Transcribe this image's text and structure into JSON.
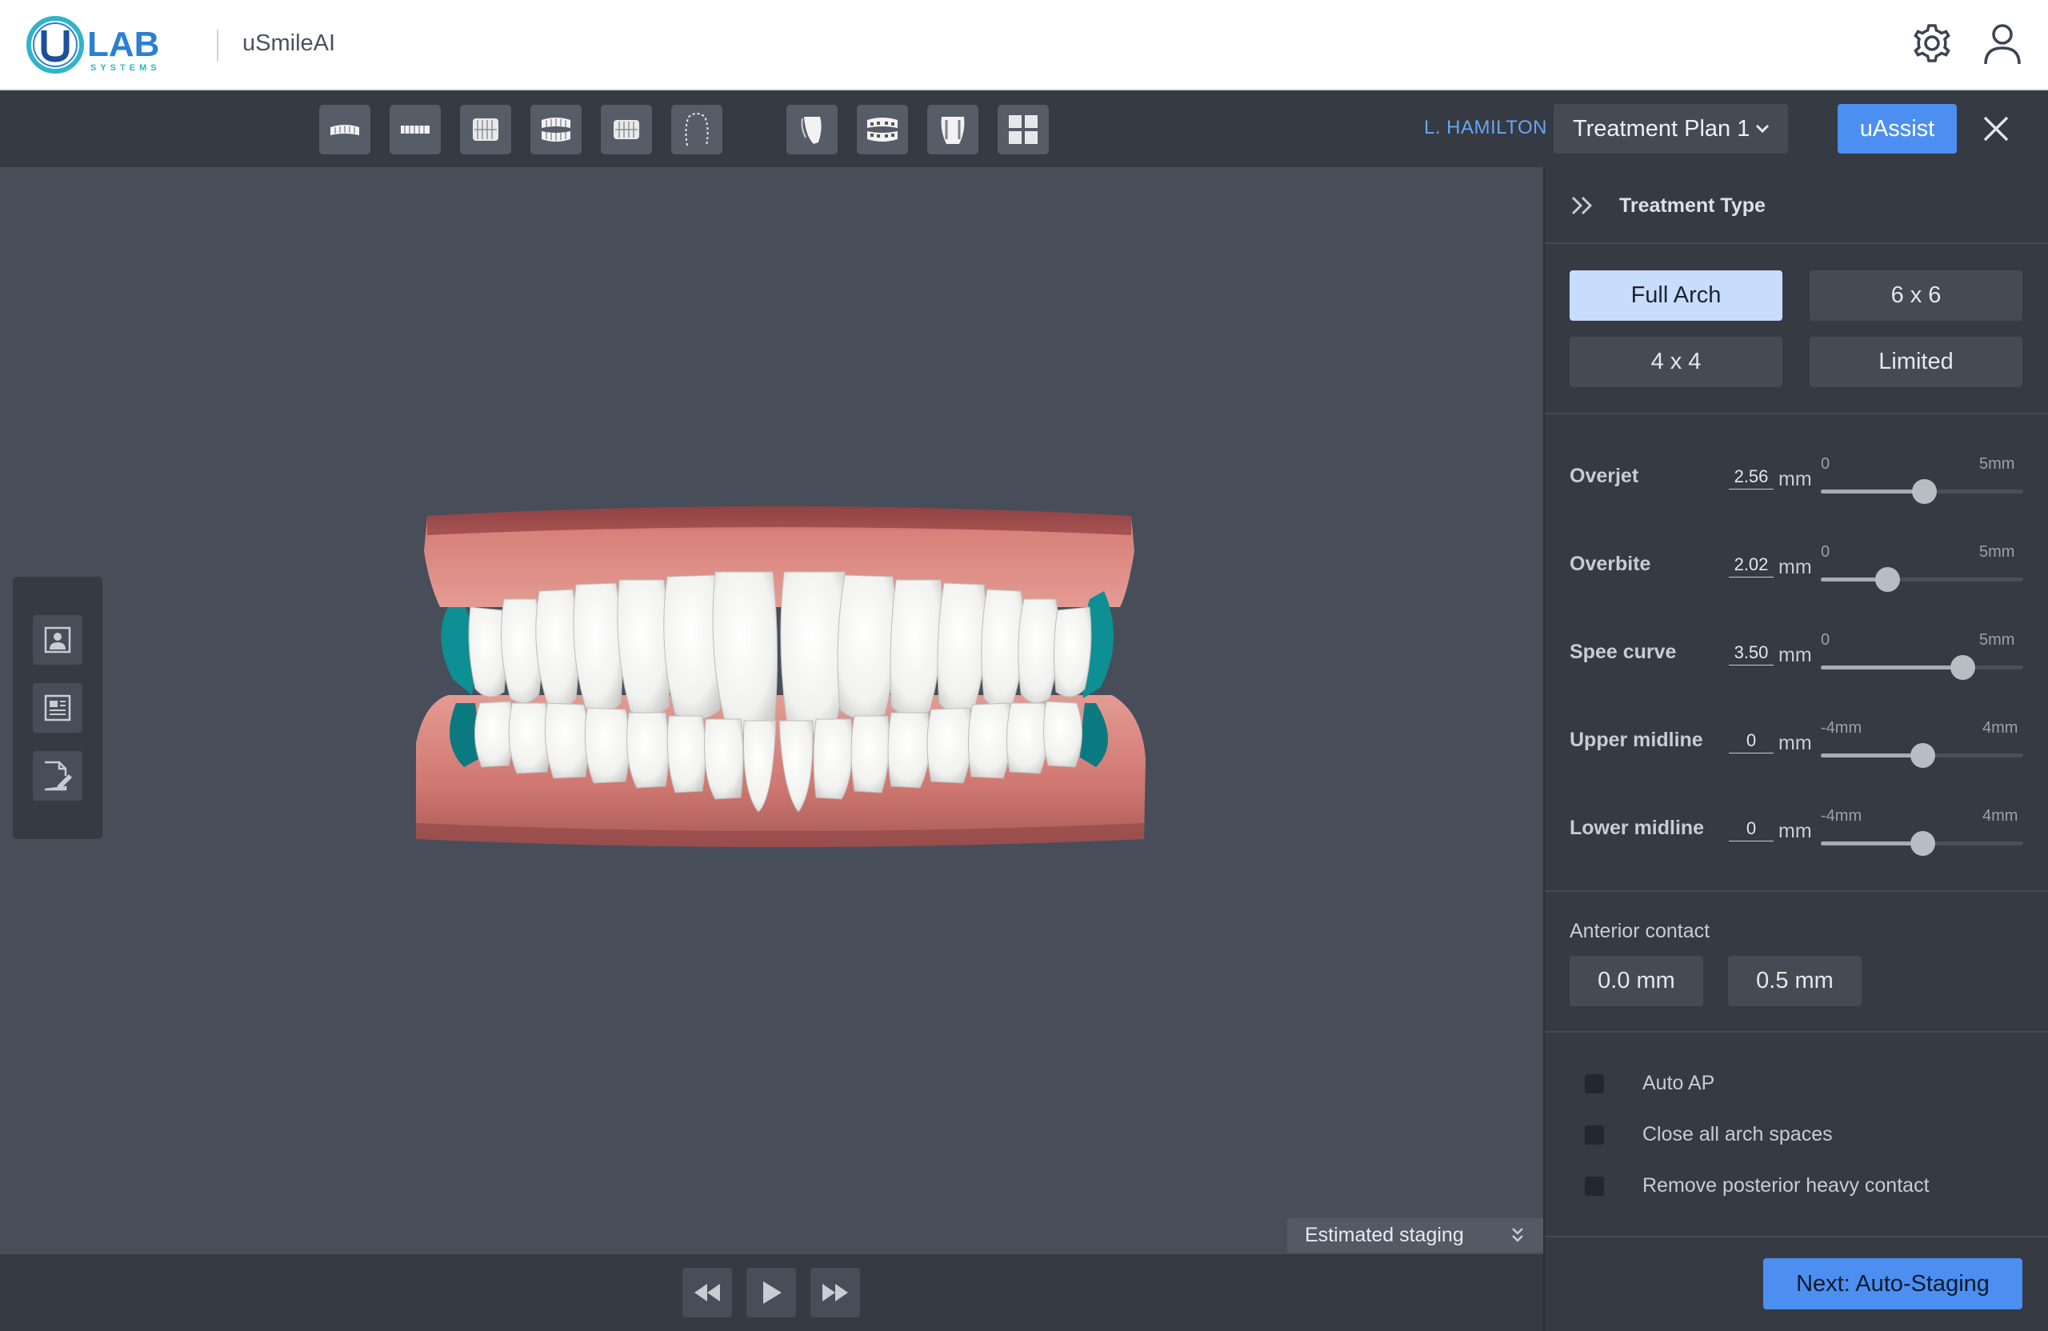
{
  "header": {
    "logo_text": "U LAB",
    "logo_subtext": "SYSTEMS",
    "app_name": "uSmileAI"
  },
  "toolbar": {
    "view_buttons": [
      "front-view-icon",
      "back-view-icon",
      "left-view-icon",
      "front-open-icon",
      "right-view-icon",
      "occlusal-outline-icon"
    ],
    "tool_buttons": [
      "tooth-icon",
      "attachments-icon",
      "tooth-outline-icon",
      "grid-icon"
    ],
    "patient_name": "L. HAMILTON",
    "plan_label": "Treatment Plan 1",
    "uassist_label": "uAssist"
  },
  "panel": {
    "title": "Treatment Type",
    "treatment_types": [
      {
        "label": "Full Arch",
        "active": true
      },
      {
        "label": "6 x 6",
        "active": false
      },
      {
        "label": "4 x 4",
        "active": false
      },
      {
        "label": "Limited",
        "active": false
      }
    ],
    "params": [
      {
        "label": "Overjet",
        "value": "2.56",
        "unit": "mm",
        "min": "0",
        "max": "5mm",
        "level": 0.51
      },
      {
        "label": "Overbite",
        "value": "2.02",
        "unit": "mm",
        "min": "0",
        "max": "5mm",
        "level": 0.33
      },
      {
        "label": "Spee curve",
        "value": "3.50",
        "unit": "mm",
        "min": "0",
        "max": "5mm",
        "level": 0.7
      },
      {
        "label": "Upper midline",
        "value": "0",
        "unit": "mm",
        "min": "-4mm",
        "max": "4mm",
        "level": 0.5
      },
      {
        "label": "Lower midline",
        "value": "0",
        "unit": "mm",
        "min": "-4mm",
        "max": "4mm",
        "level": 0.5
      }
    ],
    "anterior_contact_label": "Anterior contact",
    "anterior_contact_options": [
      "0.0 mm",
      "0.5 mm"
    ],
    "checkboxes": [
      {
        "label": "Auto AP",
        "checked": false
      },
      {
        "label": "Close all arch spaces",
        "checked": false
      },
      {
        "label": "Remove posterior heavy contact",
        "checked": false
      }
    ],
    "next_label": "Next: Auto-Staging"
  },
  "viewport": {
    "estimated_staging_label": "Estimated staging",
    "side_tools": [
      "patient-info-icon",
      "records-icon",
      "edit-notes-icon"
    ]
  },
  "colors": {
    "accent": "#4c8ff0",
    "gum": "#d8817a",
    "teeth": "#f4f4f2",
    "attachment_teal": "#0e8f94"
  }
}
